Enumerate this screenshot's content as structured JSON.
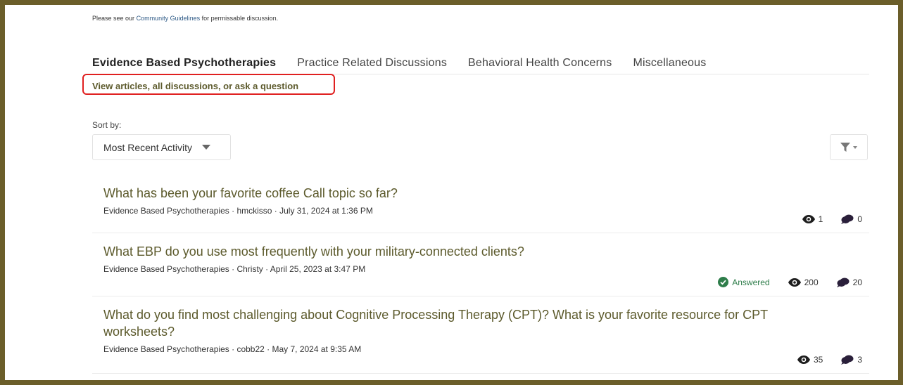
{
  "notice": {
    "prefix": "Please see our",
    "link": "Community Guidelines",
    "suffix": "for permissable discussion."
  },
  "tabs": [
    {
      "label": "Evidence Based Psychotherapies",
      "active": true
    },
    {
      "label": "Practice Related Discussions",
      "active": false
    },
    {
      "label": "Behavioral Health Concerns",
      "active": false
    },
    {
      "label": "Miscellaneous",
      "active": false
    }
  ],
  "view_link": "View articles, all discussions, or ask a question",
  "sort": {
    "label": "Sort by:",
    "value": "Most Recent Activity"
  },
  "items": [
    {
      "title": "What has been your favorite coffee Call topic so far?",
      "meta": "Evidence Based Psychotherapies · hmckisso · July 31, 2024 at 1:36 PM",
      "answered": "",
      "views": "1",
      "replies": "0"
    },
    {
      "title": "What EBP do you use most frequently with your military-connected clients?",
      "meta": "Evidence Based Psychotherapies · Christy · April 25, 2023 at 3:47 PM",
      "answered": "Answered",
      "views": "200",
      "replies": "20"
    },
    {
      "title": "What do you find most challenging about Cognitive Processing Therapy (CPT)? What is your favorite resource for CPT worksheets?",
      "meta": "Evidence Based Psychotherapies · cobb22 · May 7, 2024 at 9:35 AM",
      "answered": "",
      "views": "35",
      "replies": "3"
    }
  ],
  "colors": {
    "frame": "#6b5e2a",
    "title": "#5c5a2c",
    "highlight": "#e02020",
    "answered": "#2e7d4a"
  },
  "icons": {
    "views": "eye-icon",
    "replies": "speech-bubbles-icon",
    "answered": "check-circle-icon",
    "filter": "funnel-icon"
  }
}
